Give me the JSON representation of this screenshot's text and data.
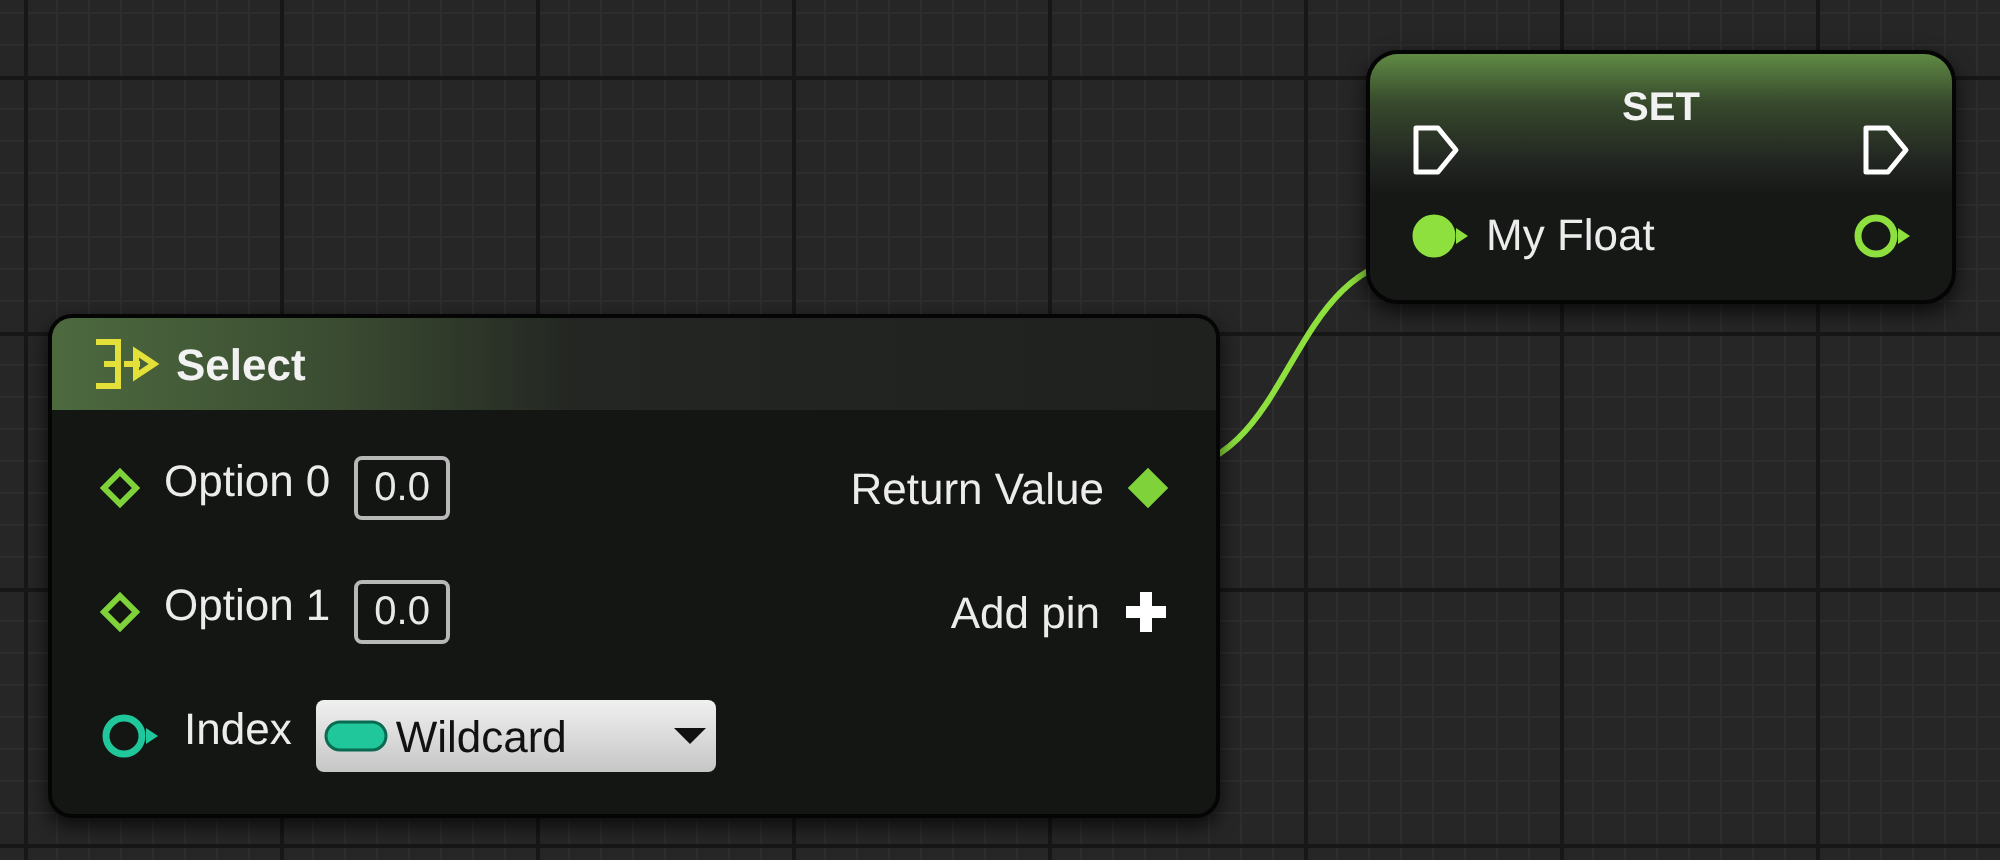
{
  "graph": {
    "nodes": [
      {
        "kind": "select",
        "title": "Select",
        "inputs": [
          {
            "kind": "diamond",
            "label": "Option 0",
            "value": "0.0",
            "connected": false,
            "color": "#7fd23a"
          },
          {
            "kind": "diamond",
            "label": "Option 1",
            "value": "0.0",
            "connected": false,
            "color": "#7fd23a"
          },
          {
            "kind": "circle",
            "label": "Index",
            "dropdown": "Wildcard",
            "connected": false,
            "color": "#1fc79a"
          }
        ],
        "outputs": [
          {
            "kind": "diamond",
            "label": "Return Value",
            "connected": true,
            "color": "#7fd23a"
          },
          {
            "kind": "add",
            "label": "Add pin"
          }
        ]
      },
      {
        "kind": "set",
        "title": "SET",
        "inputs": [
          {
            "kind": "exec",
            "connected": false
          },
          {
            "kind": "circle",
            "label": "My Float",
            "connected": true,
            "color": "#8ee03f"
          }
        ],
        "outputs": [
          {
            "kind": "exec",
            "connected": false
          },
          {
            "kind": "circle",
            "connected": false,
            "color": "#8ee03f"
          }
        ]
      }
    ]
  }
}
